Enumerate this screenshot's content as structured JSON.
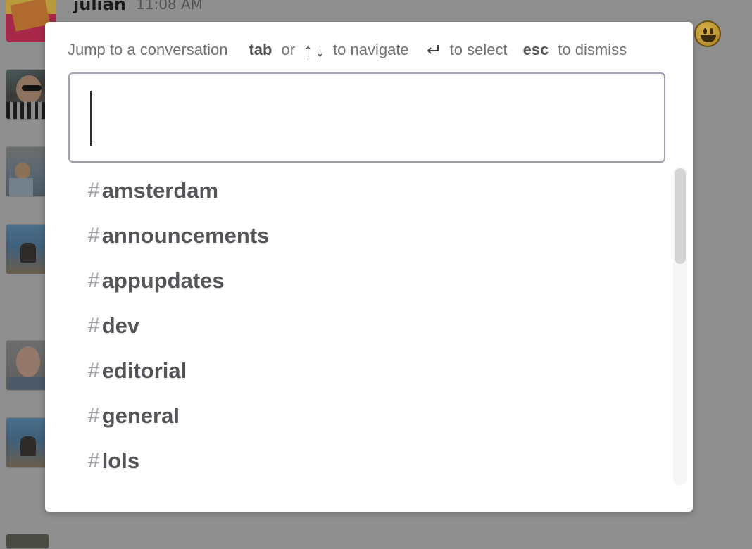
{
  "background": {
    "message_author": "julian",
    "message_time": "11:08 AM"
  },
  "switcher": {
    "hint_prompt": "Jump to a conversation",
    "key_tab": "tab",
    "word_or": "or",
    "arrow_up": "↑",
    "arrow_down": "↓",
    "hint_navigate": "to navigate",
    "hint_select": "to select",
    "key_esc": "esc",
    "hint_dismiss": "to dismiss",
    "search_value": "",
    "channels": [
      {
        "prefix": "#",
        "name": "amsterdam"
      },
      {
        "prefix": "#",
        "name": "announcements"
      },
      {
        "prefix": "#",
        "name": "appupdates"
      },
      {
        "prefix": "#",
        "name": "dev"
      },
      {
        "prefix": "#",
        "name": "editorial"
      },
      {
        "prefix": "#",
        "name": "general"
      },
      {
        "prefix": "#",
        "name": "lols"
      }
    ],
    "scroll_fraction": 0.0
  },
  "colors": {
    "overlay": "#8f8f8f",
    "modal_background": "#ffffff",
    "search_border": "#a0a0b4",
    "channel_text": "#555459",
    "hash_text": "#9e9ea6"
  }
}
